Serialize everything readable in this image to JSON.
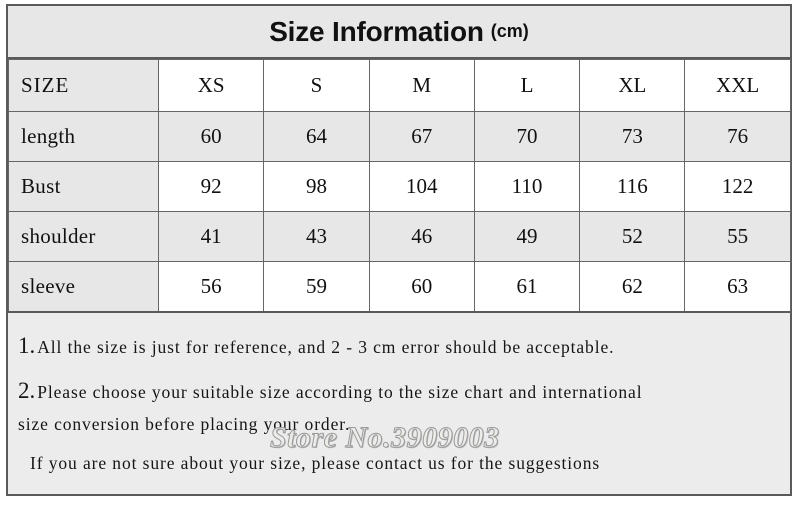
{
  "title": {
    "main": "Size Information",
    "unit": "(cm)"
  },
  "table": {
    "corner_label": "SIZE",
    "columns": [
      "XS",
      "S",
      "M",
      "L",
      "XL",
      "XXL"
    ],
    "rows": [
      {
        "label": "length",
        "values": [
          "60",
          "64",
          "67",
          "70",
          "73",
          "76"
        ],
        "shaded": true
      },
      {
        "label": "Bust",
        "values": [
          "92",
          "98",
          "104",
          "110",
          "116",
          "122"
        ],
        "shaded": false
      },
      {
        "label": "shoulder",
        "values": [
          "41",
          "43",
          "46",
          "49",
          "52",
          "55"
        ],
        "shaded": true
      },
      {
        "label": "sleeve",
        "values": [
          "56",
          "59",
          "60",
          "61",
          "62",
          "63"
        ],
        "shaded": false
      }
    ]
  },
  "notes": {
    "note1_number": "1.",
    "note1_text": "All the size is just for reference, and 2 - 3 cm error should be acceptable.",
    "note2_number": "2.",
    "note2_text": "Please choose your suitable size according to the size chart and international",
    "note2_text_cont": "size conversion before placing your order.",
    "note3_text": "If you are not sure about your size, please contact us for the suggestions"
  },
  "watermark": {
    "text": "Store No.3909003"
  },
  "colors": {
    "shade": "#e7e7e7",
    "notes_background": "#ececec",
    "border": "#5a5a5a",
    "grid": "#666666",
    "text": "#111111"
  }
}
